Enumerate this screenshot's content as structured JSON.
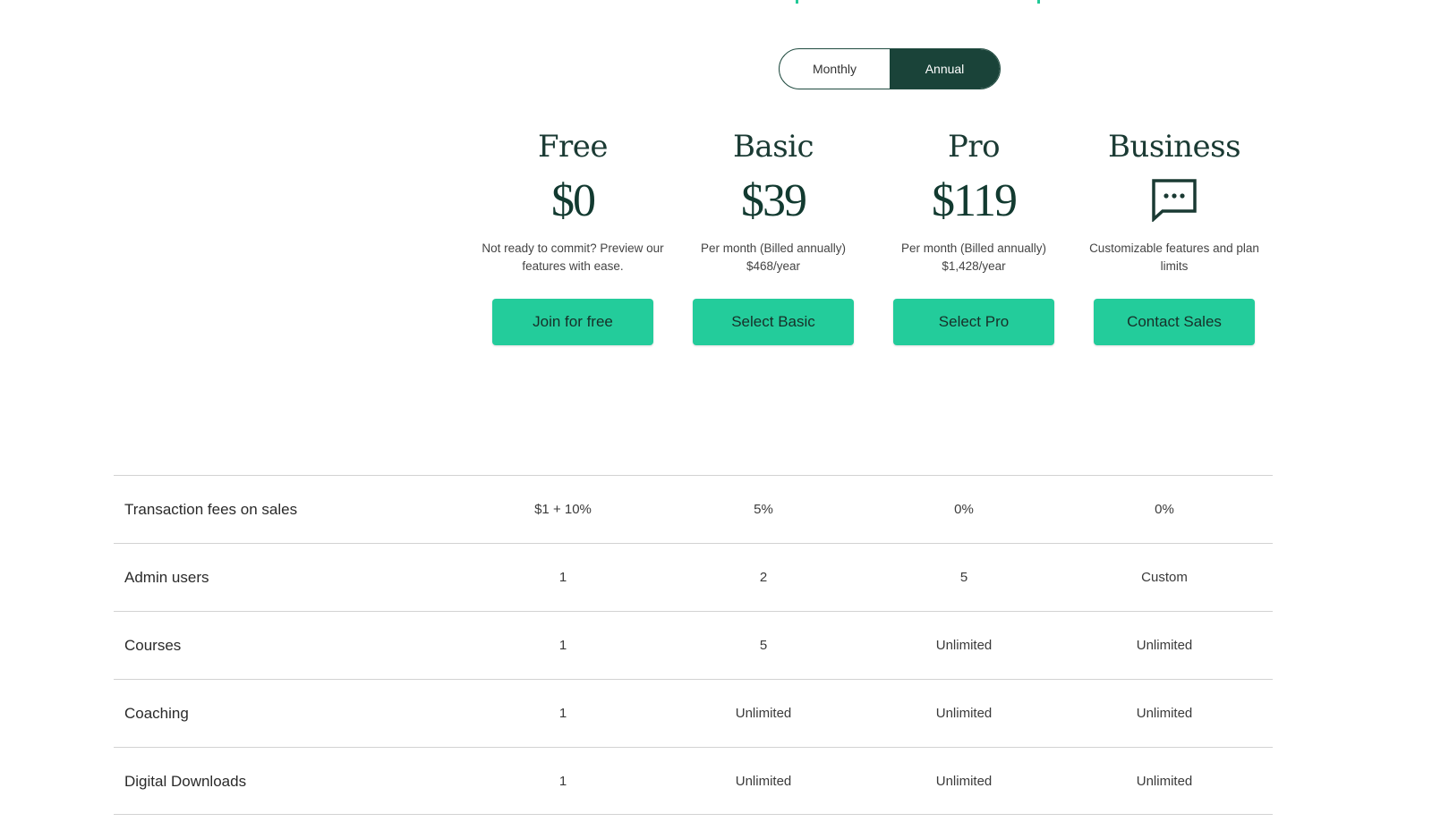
{
  "colors": {
    "accent_green": "#23cc9b",
    "dark_green": "#1a4339",
    "row_border": "#d2d2d2"
  },
  "billing_toggle": {
    "options": [
      "Monthly",
      "Annual"
    ],
    "selected": "Annual"
  },
  "plans": [
    {
      "name": "Free",
      "price": "$0",
      "description": "Not ready to commit? Preview our features with ease.",
      "button": "Join for free"
    },
    {
      "name": "Basic",
      "price": "$39",
      "description": "Per month (Billed annually) $468/year",
      "button": "Select Basic"
    },
    {
      "name": "Pro",
      "price": "$119",
      "description": "Per month (Billed annually) $1,428/year",
      "button": "Select Pro"
    },
    {
      "name": "Business",
      "icon": "chat-bubble-icon",
      "description": "Customizable features and plan limits",
      "button": "Contact Sales"
    }
  ],
  "features": [
    {
      "label": "Transaction fees on sales",
      "values": [
        "$1 + 10%",
        "5%",
        "0%",
        "0%"
      ]
    },
    {
      "label": "Admin users",
      "values": [
        "1",
        "2",
        "5",
        "Custom"
      ]
    },
    {
      "label": "Courses",
      "values": [
        "1",
        "5",
        "Unlimited",
        "Unlimited"
      ]
    },
    {
      "label": "Coaching",
      "values": [
        "1",
        "Unlimited",
        "Unlimited",
        "Unlimited"
      ]
    },
    {
      "label": "Digital Downloads",
      "values": [
        "1",
        "Unlimited",
        "Unlimited",
        "Unlimited"
      ]
    }
  ]
}
